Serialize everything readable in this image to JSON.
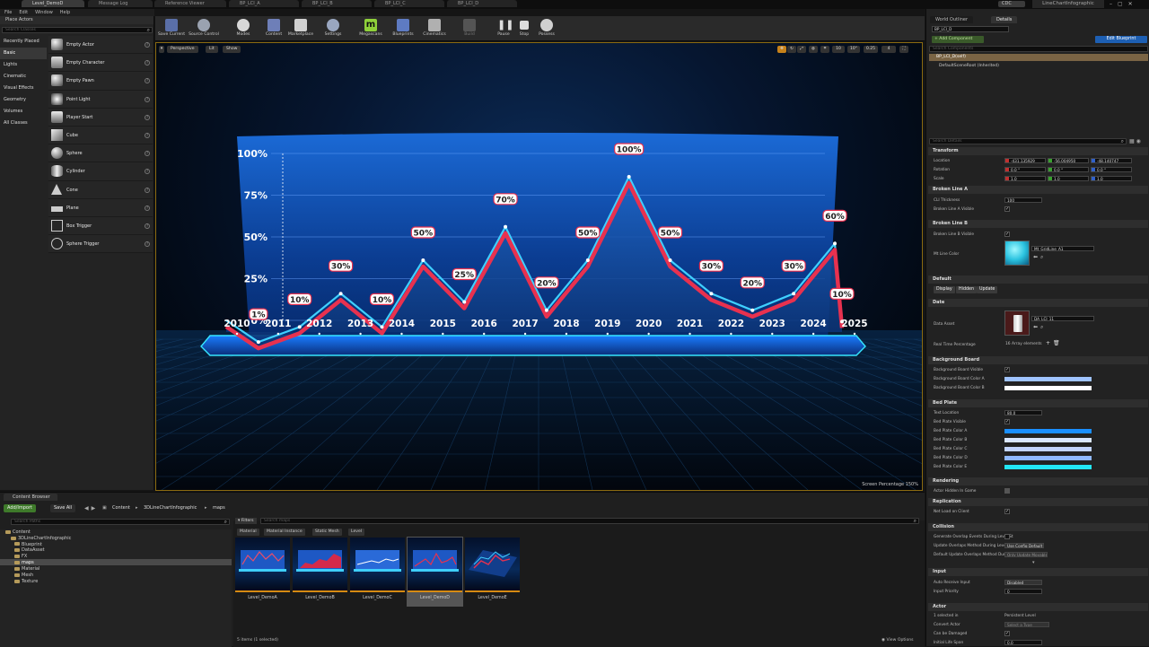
{
  "titlebar": {
    "tabs": [
      "Level_DemoD",
      "Message Log",
      "Reference Viewer",
      "BP_LCI_A",
      "BP_LCI_B",
      "BP_LCI_C",
      "BP_LCI_D"
    ],
    "project_name": "LineChartInfographic",
    "user_badge": "CDC"
  },
  "menu": [
    "File",
    "Edit",
    "Window",
    "Help"
  ],
  "place_actors": {
    "title": "Place Actors",
    "search_placeholder": "Search Classes",
    "categories": [
      "Recently Placed",
      "Basic",
      "Lights",
      "Cinematic",
      "Visual Effects",
      "Geometry",
      "Volumes",
      "All Classes"
    ],
    "selected_category": "Basic",
    "items": [
      "Empty Actor",
      "Empty Character",
      "Empty Pawn",
      "Point Light",
      "Player Start",
      "Cube",
      "Sphere",
      "Cylinder",
      "Cone",
      "Plane",
      "Box Trigger",
      "Sphere Trigger"
    ]
  },
  "toolbar": {
    "buttons": [
      "Save Current",
      "Source Control",
      "Modes",
      "Content",
      "Marketplace",
      "Settings",
      "Megascans",
      "Blueprints",
      "Cinematics",
      "Build",
      "Pause",
      "Stop",
      "Possess"
    ]
  },
  "viewport": {
    "perspective_label": "Perspective",
    "lit_label": "Lit",
    "show_label": "Show",
    "grid_snap": "10",
    "rot_snap": "10°",
    "scale_snap": "0.25",
    "cam_speed": "4",
    "screen_percentage": "Screen Percentage  150%"
  },
  "chart_data": {
    "type": "line",
    "x": [
      "2010",
      "2011",
      "2012",
      "2013",
      "2014",
      "2015",
      "2016",
      "2017",
      "2018",
      "2019",
      "2020",
      "2021",
      "2022",
      "2023",
      "2024",
      "2025"
    ],
    "point_labels": [
      null,
      "1%",
      "10%",
      "30%",
      "10%",
      "50%",
      "25%",
      "70%",
      "20%",
      "50%",
      "100%",
      "50%",
      "30%",
      "20%",
      "30%",
      "60%",
      "10%"
    ],
    "label_values": [
      1,
      10,
      30,
      10,
      50,
      25,
      70,
      20,
      50,
      100,
      50,
      30,
      20,
      30,
      60,
      10
    ],
    "y_tick_labels": [
      "100%",
      "75%",
      "50%",
      "25%",
      "0%"
    ],
    "ylim": [
      0,
      100
    ],
    "colors": {
      "line_primary": "#e8314f",
      "line_secondary": "#3fd0ff",
      "area": "#0a3f86"
    },
    "grid": true
  },
  "right_panel": {
    "tab_world_outliner": "World Outliner",
    "tab_details": "Details",
    "actor_name": "BP_LCI_D",
    "add_component": "+ Add Component",
    "edit_blueprint": "Edit Blueprint",
    "search_components": "Search Components",
    "component_root": "BP_LCI_D(self)",
    "component_child": "DefaultSceneRoot (Inherited)",
    "search_details": "Search Details",
    "transform": {
      "title": "Transform",
      "location_label": "Location",
      "rotation_label": "Rotation",
      "scale_label": "Scale",
      "location": [
        "-431.135929",
        "-56.004950",
        "-48.140747"
      ],
      "rotation": [
        "0.0 °",
        "0.0 °",
        "0.0 °"
      ],
      "scale": [
        "1.0",
        "1.0",
        "1.0"
      ]
    },
    "broken_line_a": {
      "title": "Broken Line A",
      "thickness_label": "CLI Thickness",
      "thickness": "100",
      "visible_label": "Broken Line A Visible"
    },
    "broken_line_b": {
      "title": "Broken Line B",
      "visible_label": "Broken Line B Visible",
      "color_label": "Mt Line Color",
      "material": "Mt_GridLine_A1"
    },
    "default": {
      "title": "Default",
      "buttons": [
        "Display",
        "Hidden",
        "Update"
      ]
    },
    "date": {
      "title": "Date",
      "asset_label": "Data Asset",
      "asset": "DA_LCI_11",
      "pct_label": "Real Time Percentage",
      "array_text": "16 Array elements"
    },
    "background_board": {
      "title": "Background Board",
      "visible_label": "Background Board Visible",
      "color_a_label": "Background Board Color A",
      "color_b_label": "Background Board Color B",
      "color_a": "#9fc3ff",
      "color_b": "#ffffff"
    },
    "bed_plate": {
      "title": "Bed Plate",
      "text_location_label": "Text Location",
      "text_location": "80.0",
      "visible_label": "Bed Plate Visible",
      "color_labels": [
        "Bed Plate Color A",
        "Bed Plate Color B",
        "Bed Plate Color C",
        "Bed Plate Color D",
        "Bed Plate Color E"
      ],
      "colors": [
        "#1a8fff",
        "#d9e6ff",
        "#c2d4ff",
        "#8fb8ff",
        "#22e6f5"
      ]
    },
    "rendering": {
      "title": "Rendering",
      "hidden_label": "Actor Hidden In Game"
    },
    "replication": {
      "title": "Replication",
      "net_load_label": "Net Load on Client"
    },
    "collision": {
      "title": "Collision",
      "gen_overlap_label": "Generate Overlap Events During Level St",
      "update_overlap_label": "Update Overlaps Method During Level St",
      "update_overlap_value": "Use Config Default",
      "default_update_label": "Default Update Overlaps Method During",
      "default_update_value": "Only Update Movable"
    },
    "input": {
      "title": "Input",
      "auto_receive_label": "Auto Receive Input",
      "auto_receive_value": "Disabled",
      "priority_label": "Input Priority",
      "priority_value": "0"
    },
    "actor": {
      "title": "Actor",
      "selected_label": "1 selected in",
      "selected_value": "Persistent Level",
      "convert_label": "Convert Actor",
      "convert_value": "Select a Type",
      "damaged_label": "Can be Damaged",
      "lifespan_label": "Initial Life Span",
      "lifespan_value": "0.0"
    }
  },
  "content_browser": {
    "title": "Content Browser",
    "add_import": "Add/Import",
    "save_all": "Save All",
    "path": [
      "Content",
      "3DLineChartInfographic",
      "maps"
    ],
    "search_paths": "Search Paths",
    "filters": "Filters",
    "search_maps": "Search maps",
    "tree": [
      "Content",
      "3DLineChartInfographic",
      "Blueprint",
      "DataAsset",
      "FX",
      "maps",
      "Material",
      "Mesh",
      "Texture"
    ],
    "filter_tabs": [
      "Material",
      "Material Instance",
      "Static Mesh",
      "Level"
    ],
    "assets": [
      "Level_DemoA",
      "Level_DemoB",
      "Level_DemoC",
      "Level_DemoD",
      "Level_DemoE"
    ],
    "selected_asset": "Level_DemoD",
    "status": "5 items (1 selected)",
    "view_options": "View Options"
  }
}
